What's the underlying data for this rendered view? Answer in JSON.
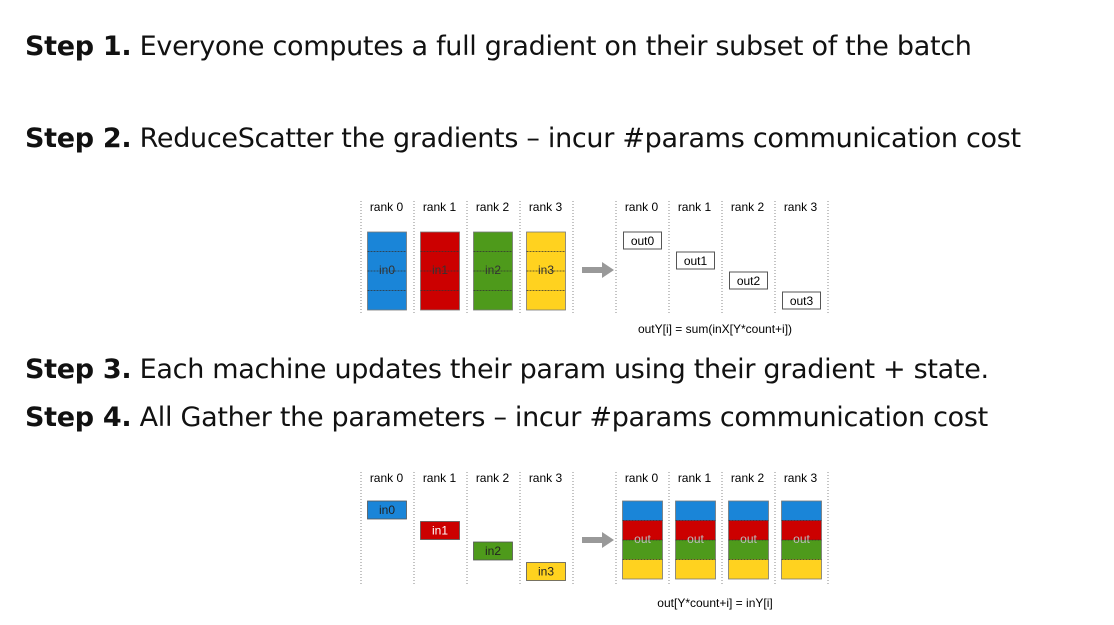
{
  "steps": [
    {
      "label": "Step 1.",
      "text": "Everyone computes a full gradient on their subset of the batch"
    },
    {
      "label": "Step 2.",
      "text": "ReduceScatter the gradients – incur #params communication cost"
    },
    {
      "label": "Step 3.",
      "text": "Each machine updates their param using their gradient + state."
    },
    {
      "label": "Step 4.",
      "text": "All Gather the parameters – incur #params communication cost"
    }
  ],
  "colors": {
    "rank0": "#1a85d8",
    "rank1": "#cc0000",
    "rank2": "#4e9a1b",
    "rank3": "#ffd21f",
    "arrow": "#999999",
    "divider": "#888888"
  },
  "reduce_scatter": {
    "ranks": [
      "rank 0",
      "rank 1",
      "rank 2",
      "rank 3"
    ],
    "inputs": [
      "in0",
      "in1",
      "in2",
      "in3"
    ],
    "outputs": [
      "out0",
      "out1",
      "out2",
      "out3"
    ],
    "arrow_icon": "right-arrow-icon",
    "formula": "outY[i] = sum(inX[Y*count+i])"
  },
  "all_gather": {
    "ranks": [
      "rank 0",
      "rank 1",
      "rank 2",
      "rank 3"
    ],
    "inputs": [
      "in0",
      "in1",
      "in2",
      "in3"
    ],
    "outputs": [
      "out",
      "out",
      "out",
      "out"
    ],
    "arrow_icon": "right-arrow-icon",
    "formula": "out[Y*count+i] = inY[i]"
  }
}
